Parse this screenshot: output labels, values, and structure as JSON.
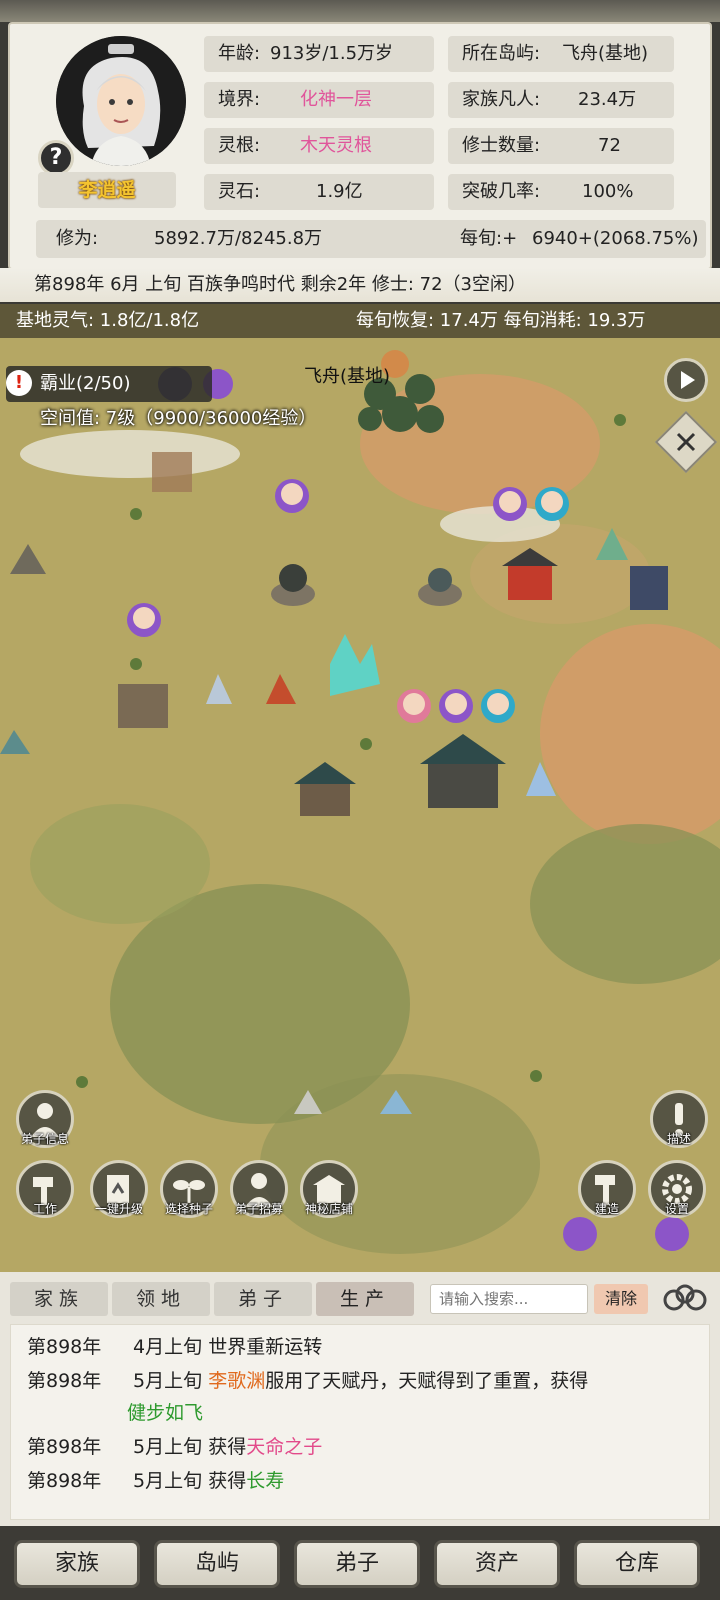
{
  "profile": {
    "name": "李逍遥",
    "age_label": "年龄:",
    "age_value": "913岁/1.5万岁",
    "realm_label": "境界:",
    "realm_value": "化神一层",
    "root_label": "灵根:",
    "root_value": "木天灵根",
    "stones_label": "灵石:",
    "stones_value": "1.9亿",
    "island_label": "所在岛屿:",
    "island_value": "飞舟(基地)",
    "mortals_label": "家族凡人:",
    "mortals_value": "23.4万",
    "cultivators_label": "修士数量:",
    "cultivators_value": "72",
    "breakthrough_label": "突破几率:",
    "breakthrough_value": "100%",
    "cultivation_label": "修为:",
    "cultivation_value": "5892.7万/8245.8万",
    "per_xun_label": "每旬:+",
    "per_xun_value": "6940+(2068.75%)",
    "help_icon": "?"
  },
  "status_line": "第898年 6月 上旬  百族争鸣时代 剩余2年  修士: 72（3空闲）",
  "map": {
    "qi_label": "基地灵气: 1.8亿/1.8亿",
    "qi_rates": "每旬恢复: 17.4万 每旬消耗: 19.3万",
    "hegemony": "霸业(2/50)",
    "space_level": "空间值: 7级（9900/36000经验）",
    "location_title": "飞舟(基地)",
    "buttons": {
      "disciple_info": "弟子信息",
      "describe": "描述",
      "work": "工作",
      "one_click_upgrade": "一键升级",
      "select_seeds": "选择种子",
      "recruit_disciples": "弟子招募",
      "mystery_shop": "神秘店铺",
      "build": "建造",
      "settings": "设置"
    },
    "icons": {
      "play": "play-icon",
      "close": "close-icon",
      "warning": "warning-icon"
    },
    "colors": {
      "grass": "#b5a764",
      "dirt": "#d99a6a",
      "dark_grass": "#8a9255"
    }
  },
  "tabs": [
    "家族",
    "领地",
    "弟子",
    "生产"
  ],
  "search": {
    "placeholder": "请输入搜索...",
    "clear_label": "清除"
  },
  "log": [
    {
      "year": "第898年",
      "time": "4月上旬",
      "text": "世界重新运转"
    },
    {
      "year": "第898年",
      "time": "5月上旬",
      "name": "李歌渊",
      "text": "服用了天赋丹，天赋得到了重置，获得",
      "trait": "健步如飞"
    },
    {
      "year": "第898年",
      "time": "5月上旬",
      "text": "获得",
      "trait": "天命之子"
    },
    {
      "year": "第898年",
      "time": "5月上旬",
      "text": "获得",
      "trait": "长寿"
    }
  ],
  "nav": [
    "家族",
    "岛屿",
    "弟子",
    "资产",
    "仓库"
  ]
}
